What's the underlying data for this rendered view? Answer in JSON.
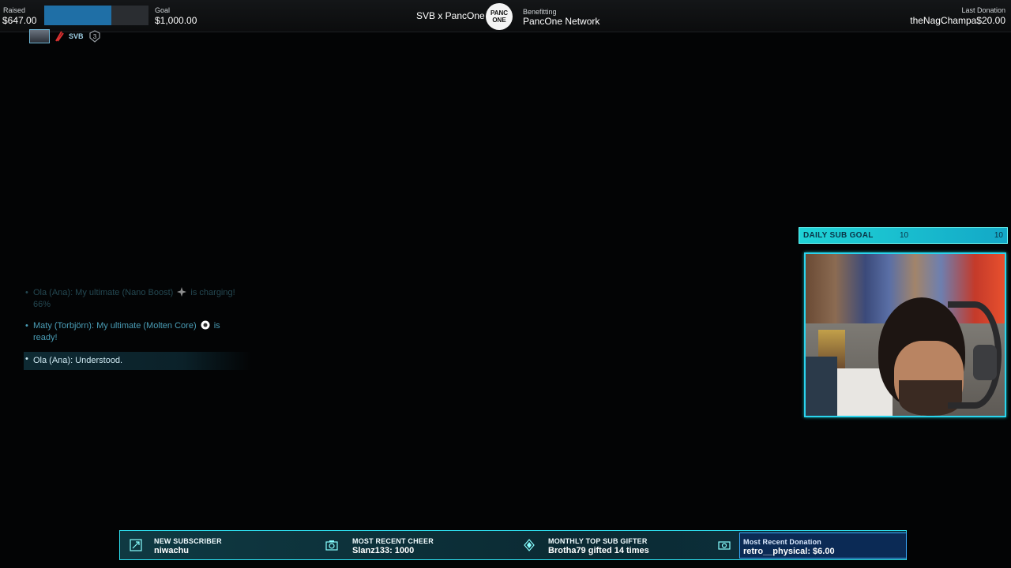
{
  "topbar": {
    "raised_label": "Raised",
    "raised_value": "$647.00",
    "goal_label": "Goal",
    "goal_value": "$1,000.00",
    "progress_fraction": 0.647,
    "center_title": "SVB x PancOne",
    "logo_text": "PANC ONE",
    "benefiting_label": "Benefitting",
    "benefiting_value": "PancOne Network",
    "last_donation_label": "Last Donation",
    "last_donation_value": "theNagChampa$20.00"
  },
  "player_row": {
    "name": "SVB",
    "badge": "3"
  },
  "chat": {
    "line1_before": "Ola (Ana): My ultimate (Nano Boost)",
    "line1_after": " is charging! 66%",
    "line2_before": "Maty (Torbjörn): My ultimate (Molten Core)",
    "line2_after": " is ready!",
    "line3": "Ola (Ana): Understood."
  },
  "subgoal": {
    "label": "DAILY SUB GOAL",
    "current": "10",
    "target": "10"
  },
  "ticker": {
    "new_sub_label": "NEW SUBSCRIBER",
    "new_sub_value": "niwachu",
    "cheer_label": "MOST RECENT CHEER",
    "cheer_value": "Slanz133: 1000",
    "gifter_label": "MONTHLY TOP SUB GIFTER",
    "gifter_value": "Brotha79 gifted 14 times",
    "donation_label": "Most Recent Donation",
    "donation_value": "retro__physical: $6.00"
  },
  "colors": {
    "accent": "#2ad4ee",
    "progress": "#1f6fa6",
    "background": "#030405"
  },
  "icons": [
    "hero-portrait",
    "elimination-icon",
    "rank-badge-icon",
    "nano-boost-icon",
    "molten-core-icon",
    "subscriber-icon",
    "camera-icon",
    "diamond-icon",
    "money-icon"
  ]
}
